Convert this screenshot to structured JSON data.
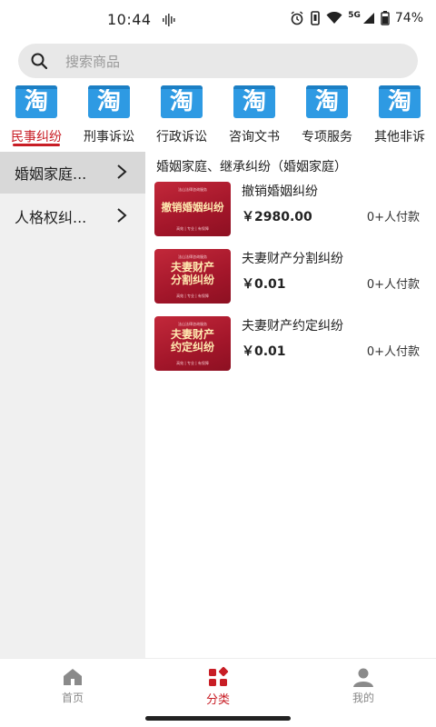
{
  "status_bar": {
    "time": "10:44",
    "network": "5G",
    "battery": "74%"
  },
  "search": {
    "placeholder": "搜索商品"
  },
  "categories": [
    {
      "icon_char": "淘",
      "label": "民事纠纷",
      "active": true
    },
    {
      "icon_char": "淘",
      "label": "刑事诉讼",
      "active": false
    },
    {
      "icon_char": "淘",
      "label": "行政诉讼",
      "active": false
    },
    {
      "icon_char": "淘",
      "label": "咨询文书",
      "active": false
    },
    {
      "icon_char": "淘",
      "label": "专项服务",
      "active": false
    },
    {
      "icon_char": "淘",
      "label": "其他非诉",
      "active": false
    }
  ],
  "sidebar": {
    "items": [
      {
        "label": "婚姻家庭...",
        "chevron": ">"
      },
      {
        "label": "人格权纠...",
        "chevron": ">"
      }
    ]
  },
  "content": {
    "section_title": "婚姻家庭、继承纠纷（婚姻家庭）",
    "products": [
      {
        "name": "撤销婚姻纠纷",
        "price": "￥2980.00",
        "sales": "0+人付款",
        "thumb_text": "撤销婚姻纠纷",
        "thumb_top": "法山法律咨询服务",
        "thumb_bottom": "高效 | 专业 | 有保障"
      },
      {
        "name": "夫妻财产分割纠纷",
        "price": "￥0.01",
        "sales": "0+人付款",
        "thumb_text": "夫妻财产\n分割纠纷",
        "thumb_top": "法山法律咨询服务",
        "thumb_bottom": "高效 | 专业 | 有保障"
      },
      {
        "name": "夫妻财产约定纠纷",
        "price": "￥0.01",
        "sales": "0+人付款",
        "thumb_text": "夫妻财产\n约定纠纷",
        "thumb_top": "法山法律咨询服务",
        "thumb_bottom": "高效 | 专业 | 有保障"
      }
    ]
  },
  "tabbar": {
    "home": "首页",
    "category": "分类",
    "mine": "我的"
  },
  "colors": {
    "accent": "#c81d25",
    "icon_blue": "#2e9ae3",
    "sidebar_bg": "#f0f0f0",
    "sidebar_active": "#d8d8d8"
  }
}
